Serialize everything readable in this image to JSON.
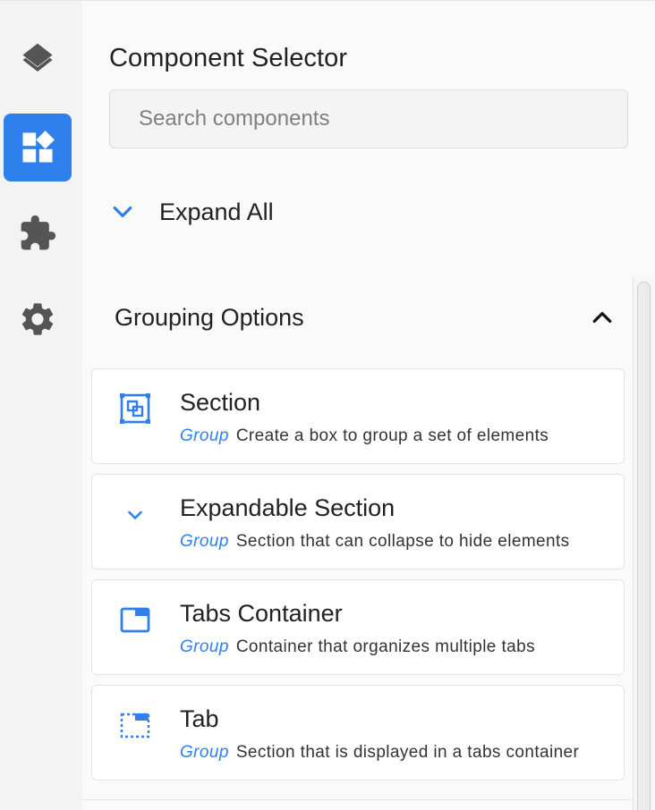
{
  "rail": {
    "items": [
      {
        "icon": "layers-icon",
        "active": false
      },
      {
        "icon": "widgets-icon",
        "active": true
      },
      {
        "icon": "puzzle-icon",
        "active": false
      },
      {
        "icon": "gear-icon",
        "active": false
      }
    ]
  },
  "panel": {
    "title": "Component Selector",
    "search": {
      "placeholder": "Search components",
      "value": ""
    },
    "expand_all_label": "Expand All",
    "group": {
      "title": "Grouping Options",
      "expanded": true,
      "items": [
        {
          "icon": "section-icon",
          "name": "Section",
          "tag": "Group",
          "description": "Create a box to group a set of elements"
        },
        {
          "icon": "chevron-down-icon",
          "name": "Expandable Section",
          "tag": "Group",
          "description": "Section that can collapse to hide elements"
        },
        {
          "icon": "tabs-container-icon",
          "name": "Tabs Container",
          "tag": "Group",
          "description": "Container that organizes multiple tabs"
        },
        {
          "icon": "tab-icon",
          "name": "Tab",
          "tag": "Group",
          "description": "Section that is displayed in a tabs container"
        }
      ]
    }
  },
  "colors": {
    "accent": "#2f80ed",
    "rail_icon": "#555555",
    "text": "#212121"
  }
}
